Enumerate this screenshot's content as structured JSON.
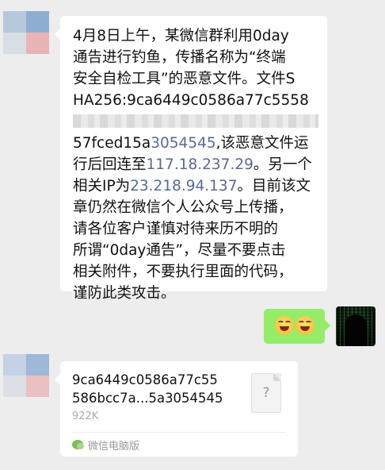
{
  "messages": [
    {
      "direction": "incoming",
      "lines": [
        [
          "4月8日上午，某微信群利用0day"
        ],
        [
          "通告进行钓鱼，传播名称为“终端"
        ],
        [
          "安全自检工具”的恶意文件。文件S"
        ],
        [
          "HA256:9ca6449c0586a77c5558"
        ],
        [],
        [
          "57fced15a",
          {
            "link": "3054545"
          },
          ",该恶意文件运"
        ],
        [
          "行后回连至",
          {
            "link": "117.18.237.29"
          },
          "。另一个"
        ],
        [
          "相关IP为",
          {
            "link": "23.218.94.137"
          },
          "。目前该文"
        ],
        [
          "章仍然在微信个人公众号上传播，"
        ],
        [
          " 请各位客户谨慎对待来历不明的"
        ],
        [
          "所谓“0day通告”，尽量不要点击"
        ],
        [
          "相关附件，不要执行里面的代码，"
        ],
        [
          "谨防此类攻击。"
        ]
      ]
    },
    {
      "direction": "outgoing",
      "emojis": [
        "grin-emoji",
        "grin-emoji"
      ]
    },
    {
      "direction": "incoming",
      "file": {
        "name_line1": "9ca6449c0586a77c55",
        "name_line2": "586bcc7a...5a3054545",
        "size": "922K",
        "icon_glyph": "?",
        "source": "微信电脑版"
      }
    }
  ],
  "colors": {
    "background": "#ededed",
    "incoming_bubble": "#ffffff",
    "outgoing_bubble": "#95ec69",
    "link": "#576b95"
  }
}
